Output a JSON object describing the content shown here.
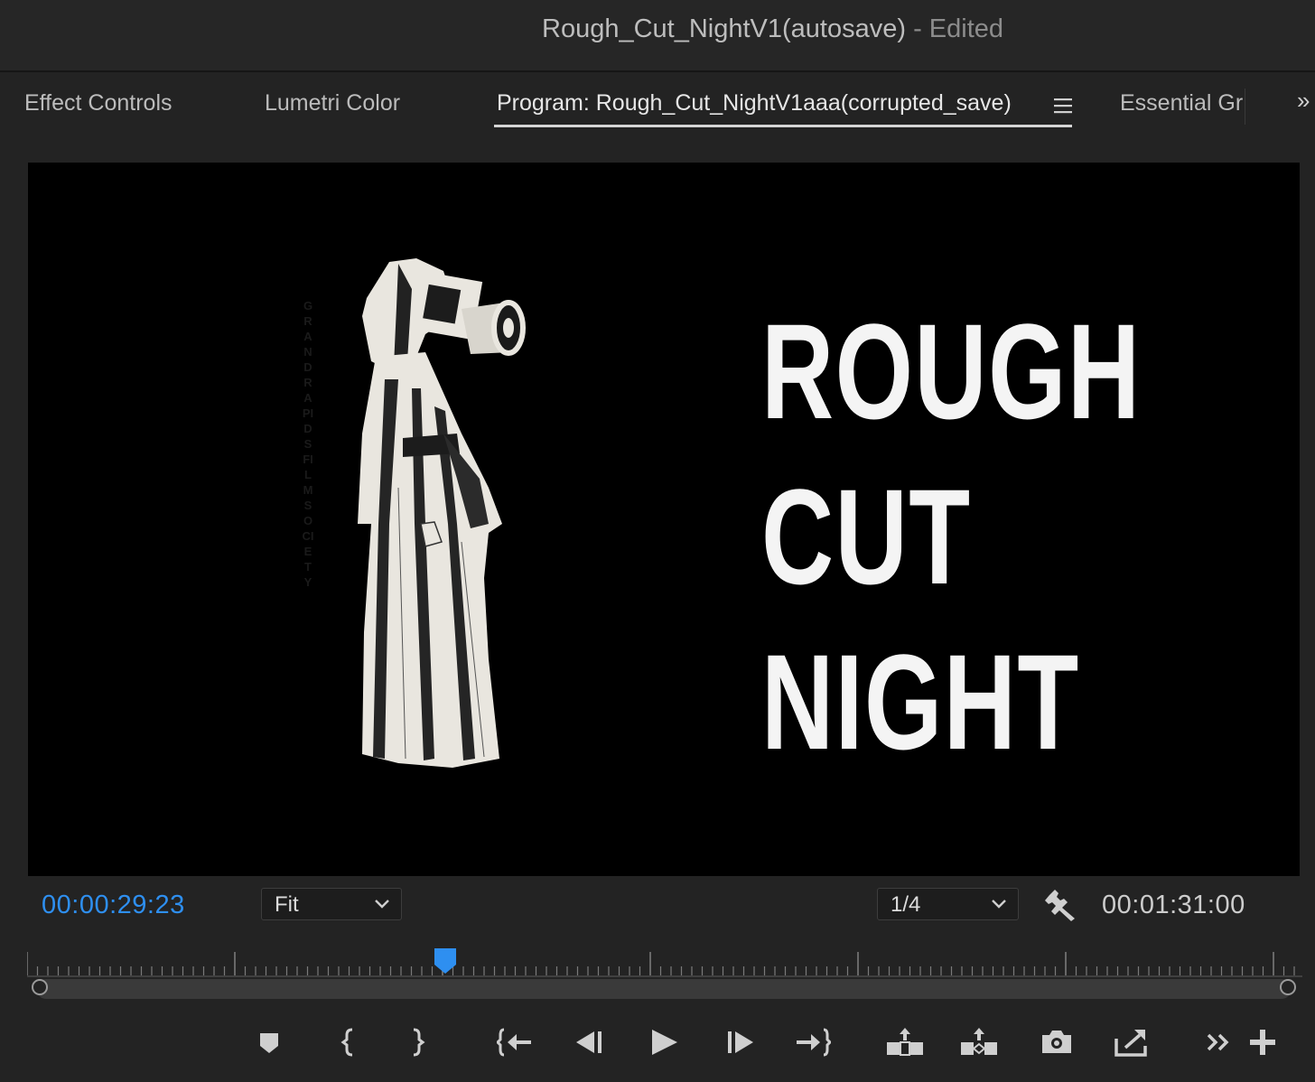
{
  "window": {
    "title_main": "Rough_Cut_NightV1(autosave)",
    "title_status": " - Edited"
  },
  "tabs": {
    "effect_controls": "Effect Controls",
    "lumetri_color": "Lumetri Color",
    "program": "Program: Rough_Cut_NightV1aaa(corrupted_save)",
    "essential_graphics": "Essential Gr",
    "overflow": "»"
  },
  "viewer": {
    "poster_lines": [
      "ROUGH",
      "CUT",
      "NIGHT"
    ],
    "vertical_caption": "GRAND RAPIDS FILM SOCIETY"
  },
  "transport": {
    "current_timecode": "00:00:29:23",
    "duration_timecode": "00:01:31:00",
    "zoom_select": "Fit",
    "resolution_select": "1/4",
    "playhead_fraction": 0.328
  },
  "colors": {
    "accent_blue": "#2e8ff0",
    "panel_bg": "#232323",
    "viewer_bg": "#000000"
  },
  "icons": [
    "add-marker-icon",
    "mark-in-icon",
    "mark-out-icon",
    "go-to-in-icon",
    "step-back-icon",
    "play-icon",
    "step-forward-icon",
    "go-to-out-icon",
    "lift-icon",
    "extract-icon",
    "export-frame-icon",
    "insert-icon",
    "more-controls-icon",
    "add-button-icon"
  ]
}
